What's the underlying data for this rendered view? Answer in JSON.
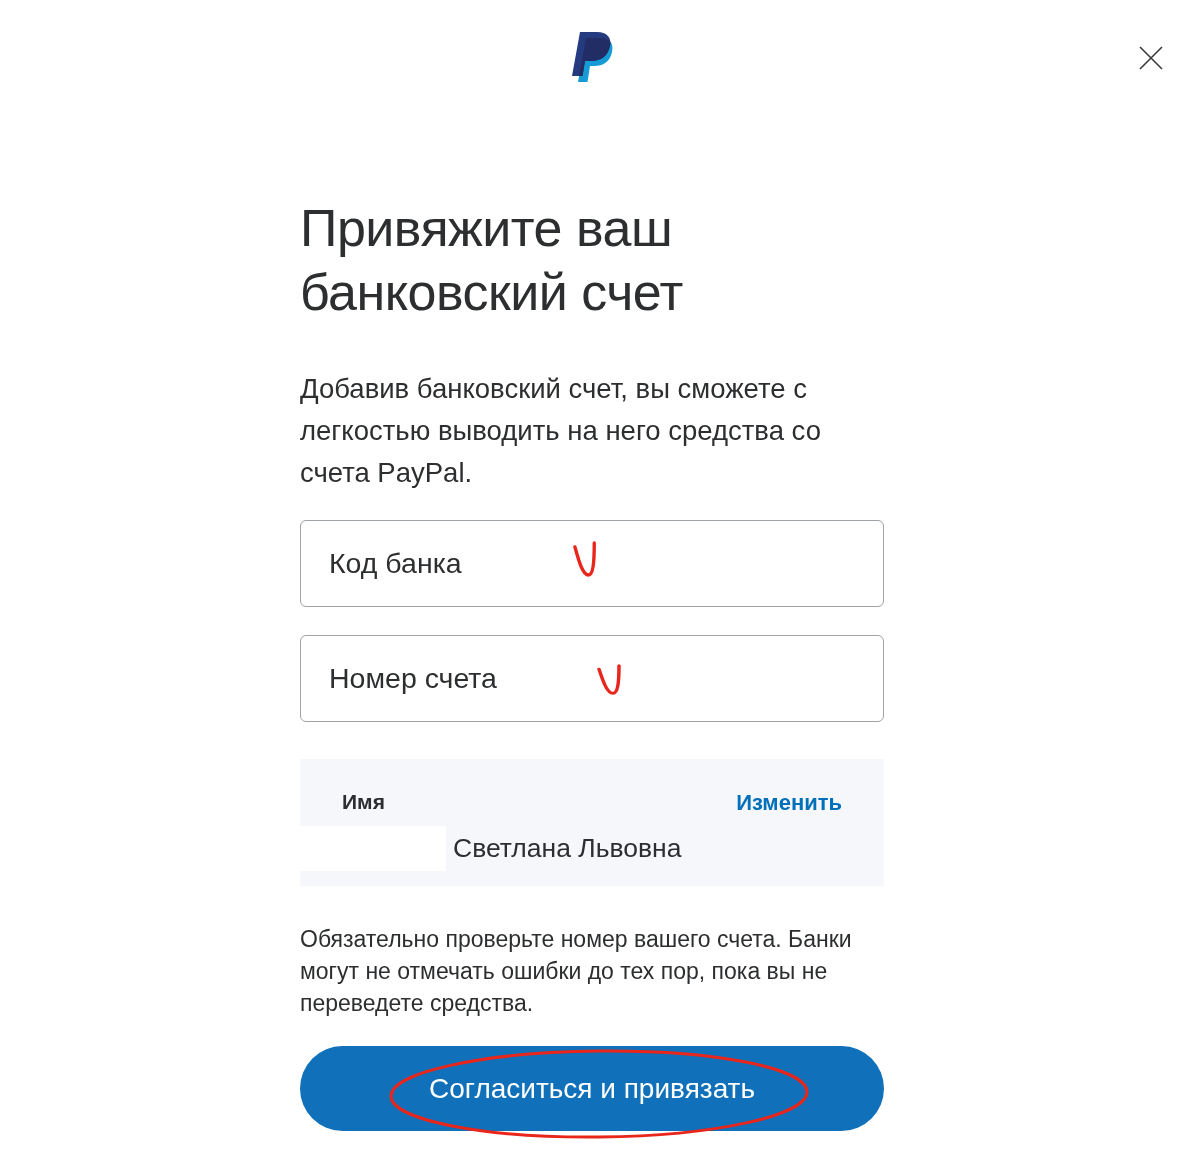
{
  "heading": "Привяжите ваш банковский счет",
  "intro": "Добавив банковский счет, вы сможете с легкостью выводить на него средства со счета PayPal.",
  "fields": [
    {
      "placeholder": "Код банка",
      "marked": true
    },
    {
      "placeholder": "Номер счета",
      "marked": true
    }
  ],
  "name_panel": {
    "label": "Имя",
    "edit_link": "Изменить",
    "value": "Светлана Львовна"
  },
  "notice": "Обязательно проверьте номер вашего счета. Банки могут не отмечать ошибки до тех пор, пока вы не переведете средства.",
  "submit_button": {
    "label": "Согласиться и привязать",
    "circled": true
  }
}
